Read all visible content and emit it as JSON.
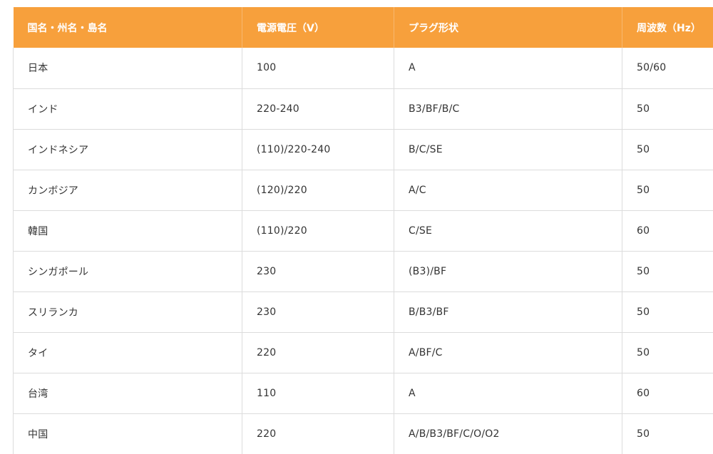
{
  "table": {
    "headers": [
      "国名・州名・島名",
      "電源電圧（V）",
      "プラグ形状",
      "周波数（Hz）"
    ],
    "rows": [
      [
        "日本",
        "100",
        "A",
        "50/60"
      ],
      [
        "インド",
        "220-240",
        "B3/BF/B/C",
        "50"
      ],
      [
        "インドネシア",
        "(110)/220-240",
        "B/C/SE",
        "50"
      ],
      [
        "カンボジア",
        "(120)/220",
        "A/C",
        "50"
      ],
      [
        "韓国",
        "(110)/220",
        "C/SE",
        "60"
      ],
      [
        "シンガポール",
        "230",
        "(B3)/BF",
        "50"
      ],
      [
        "スリランカ",
        "230",
        "B/B3/BF",
        "50"
      ],
      [
        "タイ",
        "220",
        "A/BF/C",
        "50"
      ],
      [
        "台湾",
        "110",
        "A",
        "60"
      ],
      [
        "中国",
        "220",
        "A/B/B3/BF/C/O/O2",
        "50"
      ]
    ]
  },
  "colors": {
    "header_bg": "#f7a03c",
    "header_text": "#ffffff",
    "border": "#dcdcdc",
    "text": "#333333"
  }
}
